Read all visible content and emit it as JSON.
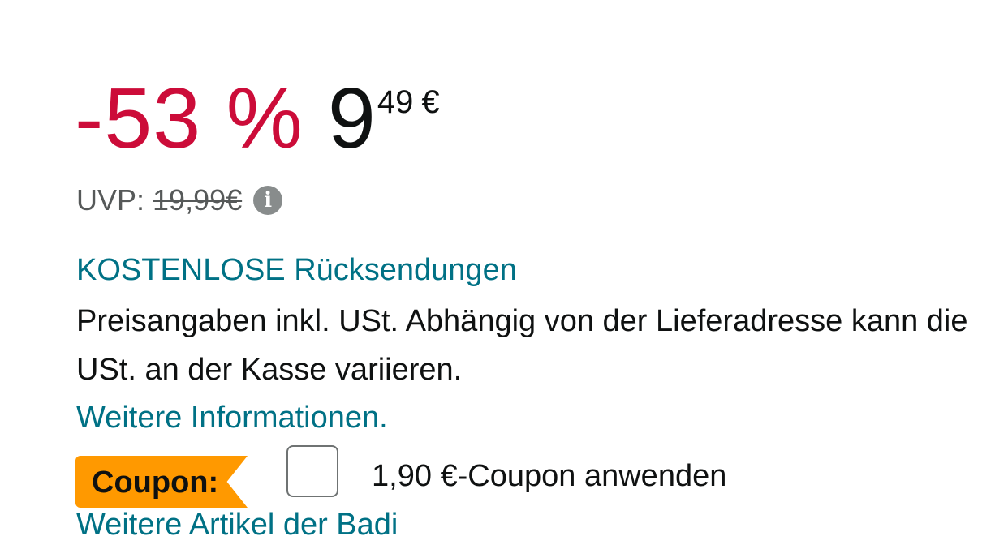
{
  "price": {
    "discount": "-53 %",
    "whole": "9",
    "fraction": "49",
    "currency": "€"
  },
  "uvp": {
    "label": "UVP:",
    "value": "19,99€",
    "info_icon": "info-icon"
  },
  "returns_link": "KOSTENLOSE Rücksendungen",
  "tax_text": "Preisangaben inkl. USt. Abhängig von der Lieferadresse kann die USt. an der Kasse variieren.",
  "more_info_link": "Weitere Informationen.",
  "coupon": {
    "badge_label": "Coupon:",
    "checkbox_checked": false,
    "apply_text": "1,90 €-Coupon anwenden"
  },
  "cut_off_link": "Weitere Artikel der Badi",
  "colors": {
    "discount": "#cc0c39",
    "link": "#007185",
    "coupon_badge": "#ff9900"
  }
}
